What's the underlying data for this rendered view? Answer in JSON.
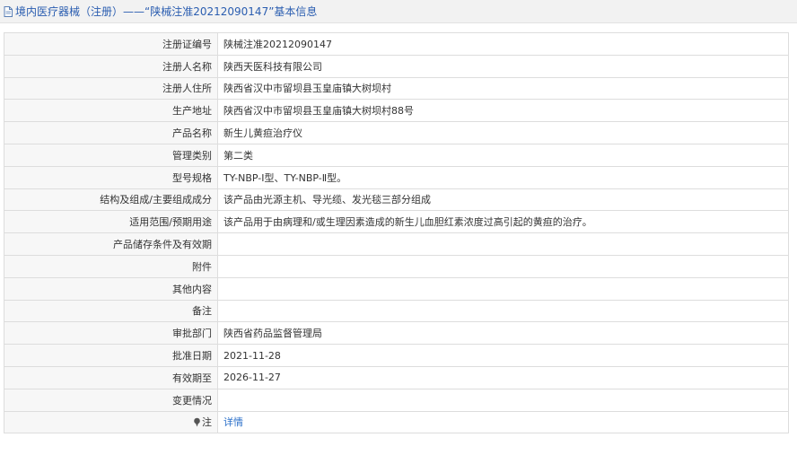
{
  "header": {
    "title": "境内医疗器械（注册）——“陕械注准20212090147”基本信息",
    "icon": "document-icon"
  },
  "rows": [
    {
      "label": "注册证编号",
      "value": "陕械注准20212090147"
    },
    {
      "label": "注册人名称",
      "value": "陕西天医科技有限公司"
    },
    {
      "label": "注册人住所",
      "value": "陕西省汉中市留坝县玉皇庙镇大树坝村"
    },
    {
      "label": "生产地址",
      "value": "陕西省汉中市留坝县玉皇庙镇大树坝村88号"
    },
    {
      "label": "产品名称",
      "value": "新生儿黄疸治疗仪"
    },
    {
      "label": "管理类别",
      "value": "第二类"
    },
    {
      "label": "型号规格",
      "value": "TY-NBP-Ⅰ型、TY-NBP-Ⅱ型。"
    },
    {
      "label": "结构及组成/主要组成成分",
      "value": "该产品由光源主机、导光缆、发光毯三部分组成"
    },
    {
      "label": "适用范围/预期用途",
      "value": "该产品用于由病理和/或生理因素造成的新生儿血胆红素浓度过高引起的黄疸的治疗。"
    },
    {
      "label": "产品储存条件及有效期",
      "value": ""
    },
    {
      "label": "附件",
      "value": ""
    },
    {
      "label": "其他内容",
      "value": ""
    },
    {
      "label": "备注",
      "value": ""
    },
    {
      "label": "审批部门",
      "value": "陕西省药品监督管理局"
    },
    {
      "label": "批准日期",
      "value": "2021-11-28"
    },
    {
      "label": "有效期至",
      "value": "2026-11-27"
    },
    {
      "label": "变更情况",
      "value": ""
    }
  ],
  "note": {
    "label": "注",
    "icon": "pin-icon",
    "link_text": "详情"
  },
  "colors": {
    "title": "#2a5db0",
    "link": "#2a6fc9",
    "label_bg": "#f7f7f7",
    "border": "#dddddd",
    "header_bg": "#f2f2f2"
  }
}
